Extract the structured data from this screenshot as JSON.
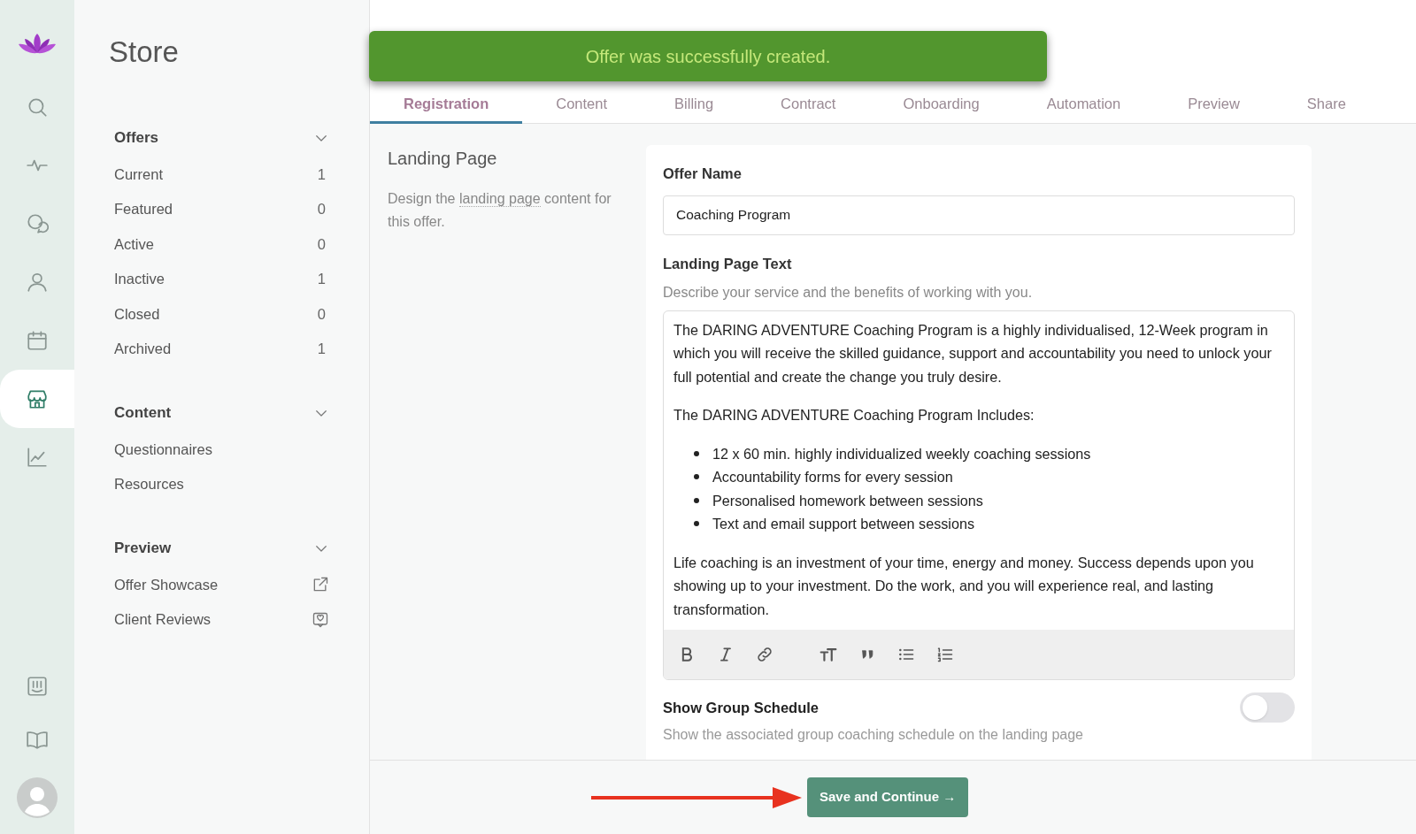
{
  "rail": {
    "items": [
      {
        "selected": false
      },
      {
        "selected": false
      },
      {
        "selected": false
      },
      {
        "selected": false
      },
      {
        "selected": false
      },
      {
        "selected": true
      },
      {
        "selected": false
      }
    ]
  },
  "sidebar": {
    "title": "Store",
    "sections": [
      {
        "title": "Offers",
        "expanded": true,
        "items": [
          {
            "label": "Current",
            "count": "1"
          },
          {
            "label": "Featured",
            "count": "0"
          },
          {
            "label": "Active",
            "count": "0"
          },
          {
            "label": "Inactive",
            "count": "1"
          },
          {
            "label": "Closed",
            "count": "0"
          },
          {
            "label": "Archived",
            "count": "1"
          }
        ]
      },
      {
        "title": "Content",
        "expanded": true,
        "items": [
          {
            "label": "Questionnaires"
          },
          {
            "label": "Resources"
          }
        ]
      },
      {
        "title": "Preview",
        "expanded": true,
        "items": [
          {
            "label": "Offer Showcase"
          },
          {
            "label": "Client Reviews"
          }
        ]
      }
    ]
  },
  "toast": {
    "message": "Offer was successfully created."
  },
  "tabs": [
    {
      "label": "Registration",
      "selected": true
    },
    {
      "label": "Content",
      "selected": false
    },
    {
      "label": "Billing",
      "selected": false
    },
    {
      "label": "Contract",
      "selected": false
    },
    {
      "label": "Onboarding",
      "selected": false
    },
    {
      "label": "Automation",
      "selected": false
    },
    {
      "label": "Preview",
      "selected": false
    },
    {
      "label": "Share",
      "selected": false
    }
  ],
  "section": {
    "title": "Landing Page",
    "description_before": "Design the",
    "description_link": "landing page",
    "description_after": "content for this offer."
  },
  "form": {
    "offer_name": {
      "label": "Offer Name",
      "value": "Coaching Program"
    },
    "landing_text": {
      "label": "Landing Page Text",
      "help": "Describe your service and the benefits of working with you.",
      "blocks": [
        {
          "kind": "paragraph",
          "text": "The DARING ADVENTURE Coaching Program is a highly individualised, 12-Week program in which you will receive the skilled guidance, support and accountability you need to unlock your full potential and create the change you truly desire."
        },
        {
          "kind": "paragraph",
          "text": "The DARING ADVENTURE Coaching Program Includes:"
        },
        {
          "kind": "list",
          "items": [
            "12 x 60 min. highly individualized weekly coaching sessions",
            "Accountability forms for every session",
            "Personalised homework between sessions",
            "Text and email support between sessions"
          ]
        },
        {
          "kind": "paragraph",
          "text": "Life coaching is an investment of your time, energy and money. Success depends upon you showing up to your investment. Do the work, and you will experience real, and lasting transformation."
        }
      ]
    },
    "group_schedule": {
      "label": "Show Group Schedule",
      "on": false,
      "help": "Show the associated group coaching schedule on the landing page"
    }
  },
  "footer": {
    "button": "Save and Continue →"
  }
}
